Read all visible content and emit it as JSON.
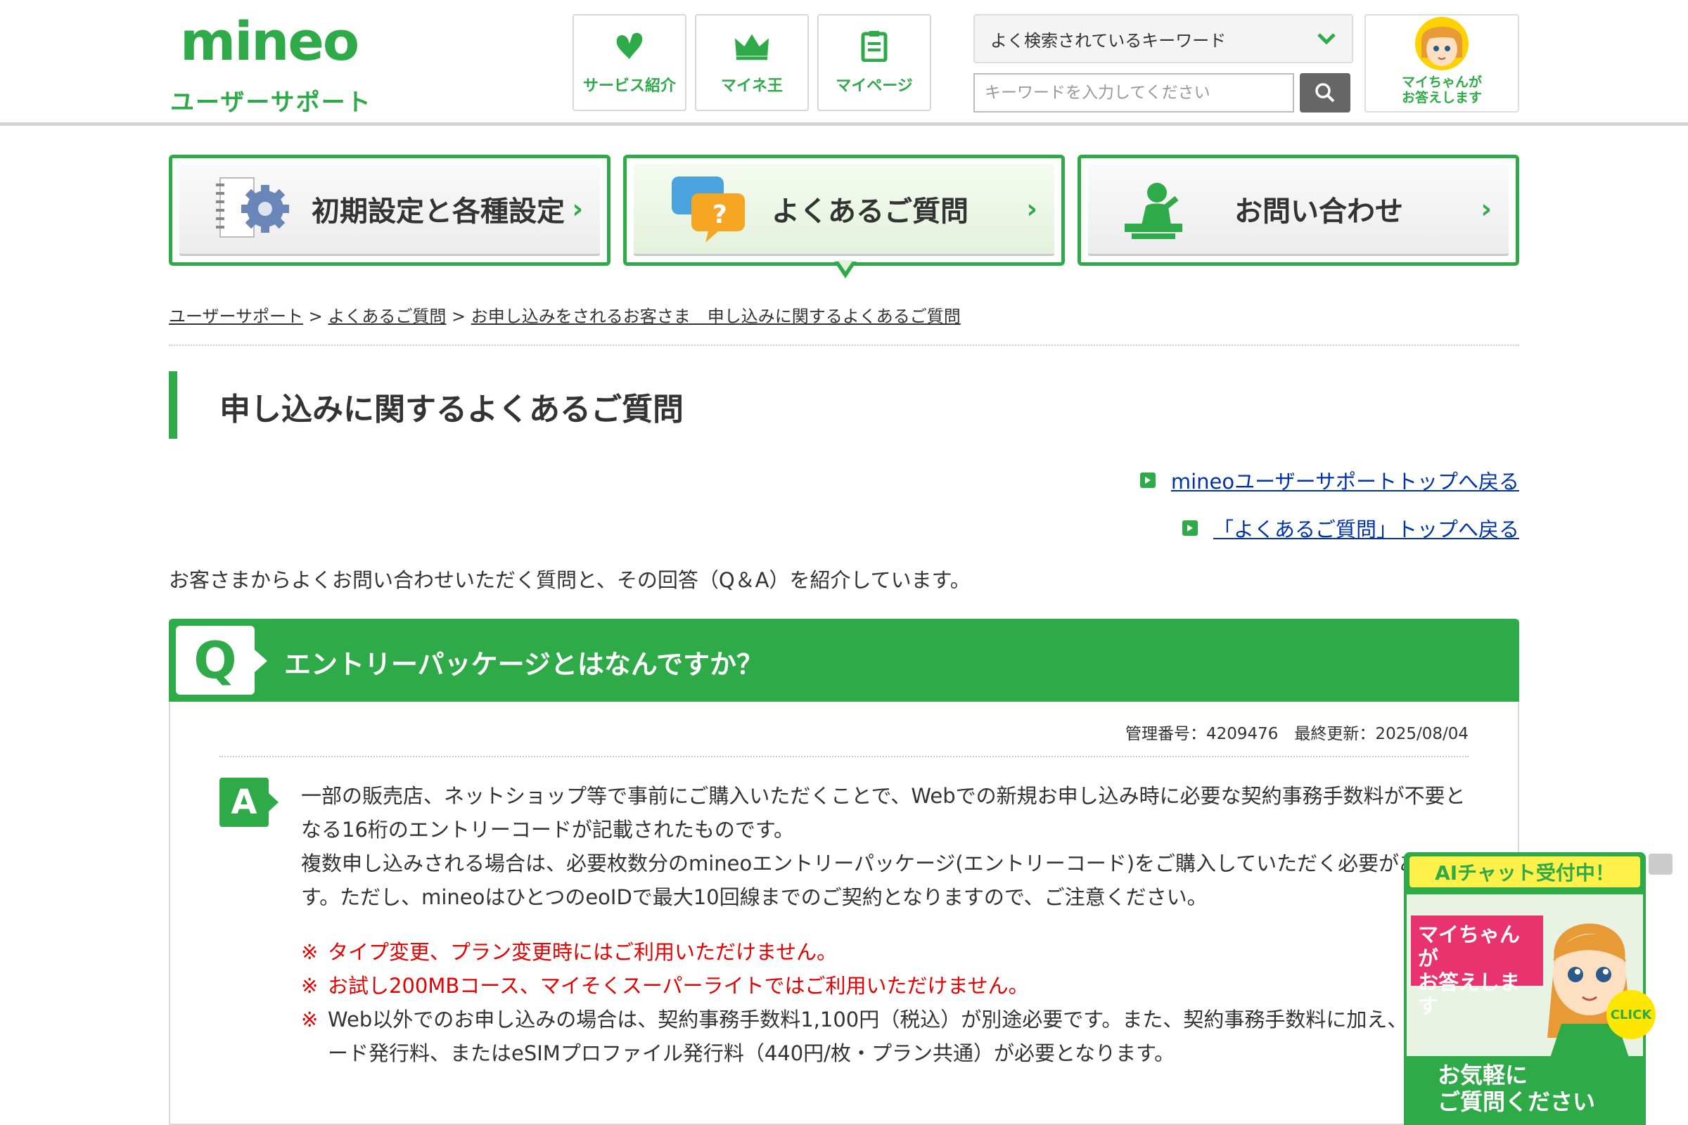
{
  "brand": {
    "logo": "mineo",
    "subtitle": "ユーザーサポート"
  },
  "header": {
    "buttons": [
      {
        "label": "サービス紹介",
        "icon": "heart-leaf-icon"
      },
      {
        "label": "マイネ王",
        "icon": "crown-icon"
      },
      {
        "label": "マイページ",
        "icon": "clipboard-icon"
      }
    ],
    "search": {
      "select_value": "よく検索されているキーワード",
      "placeholder": "キーワードを入力してください"
    },
    "mai_chan": {
      "label": "マイちゃんが\nお答えします"
    }
  },
  "nav": [
    {
      "label": "初期設定と各種設定",
      "icon": "gear-notebook-icon",
      "active": false
    },
    {
      "label": "よくあるご質問",
      "icon": "question-bubble-icon",
      "active": true
    },
    {
      "label": "お問い合わせ",
      "icon": "operator-icon",
      "active": false
    }
  ],
  "breadcrumb": {
    "items": [
      "ユーザーサポート",
      "よくあるご質問",
      "お申し込みをされるお客さま　申し込みに関するよくあるご質問"
    ],
    "separator": " > "
  },
  "page": {
    "title": "申し込みに関するよくあるご質問",
    "back_links": [
      "mineoユーザーサポートトップへ戻る",
      "「よくあるご質問」トップへ戻る"
    ],
    "intro": "お客さまからよくお問い合わせいただく質問と、その回答（Q＆A）を紹介しています。"
  },
  "qa": {
    "q_mark": "Q",
    "question": "エントリーパッケージとはなんですか？",
    "meta": "管理番号：4209476　最終更新：2025/08/04",
    "a_mark": "A",
    "answer_lines": [
      "一部の販売店、ネットショップ等で事前にご購入いただくことで、Webでの新規お申し込み時に必要な契約事務手数料が不要となる16桁のエントリーコードが記載されたものです。",
      "複数申し込みされる場合は、必要枚数分のmineoエントリーパッケージ(エントリーコード)をご購入していただく必要があります。ただし、mineoはひとつのeoIDで最大10回線までのご契約となりますので、ご注意ください。"
    ],
    "notes": [
      {
        "mark": "※",
        "text": "タイプ変更、プラン変更時にはご利用いただけません。",
        "red": true
      },
      {
        "mark": "※",
        "text": "お試し200MBコース、マイそくスーパーライトではご利用いただけません。",
        "red": true
      },
      {
        "mark": "※",
        "text": "Web以外でのお申し込みの場合は、契約事務手数料1,100円（税込）が別途必要です。また、契約事務手数料に加え、SIMカード発行料、またはeSIMプロファイル発行料（440円/枚・プラン共通）が必要となります。",
        "red": false
      }
    ]
  },
  "chat_widget": {
    "header": "AIチャット受付中！",
    "badge": "マイちゃんが\nお答えします",
    "click": "CLICK",
    "footer": "お気軽に\nご質問ください"
  },
  "colors": {
    "brand_green": "#2eaa48",
    "link_blue": "#0033aa",
    "note_red": "#e60000",
    "chat_yellow": "#fff04a",
    "chat_pink": "#e8336e"
  }
}
